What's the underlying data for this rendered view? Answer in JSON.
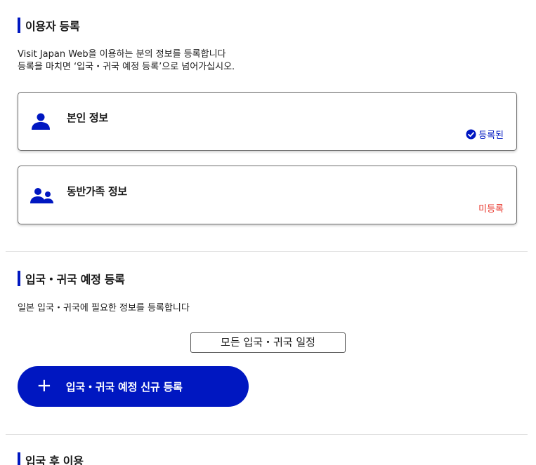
{
  "user_registration": {
    "heading": "이용자 등록",
    "desc_line1": "Visit Japan Web을 이용하는 분의 정보를 등록합니다",
    "desc_line2": "등록을 마치면 ‘입국・귀국 예정 등록’으로 넘어가십시오.",
    "personal_card": {
      "title": "본인 정보",
      "status": "등록된",
      "status_color": "#0017c1",
      "icon": "person-icon"
    },
    "companion_card": {
      "title": "동반가족 정보",
      "status": "미등록",
      "status_color": "#e8372c",
      "icon": "group-icon"
    }
  },
  "entry_registration": {
    "heading": "입국・귀국 예정 등록",
    "desc": "일본 입국・귀국에 필요한 정보를 등록합니다",
    "all_schedules_button": "모든 입국・귀국 일정",
    "new_registration_button": "입국・귀국 예정 신규 등록",
    "plus_icon": "plus-icon"
  },
  "after_entry": {
    "heading": "입국 후 이용"
  },
  "colors": {
    "accent": "#0017c1",
    "pending": "#e8372c"
  }
}
